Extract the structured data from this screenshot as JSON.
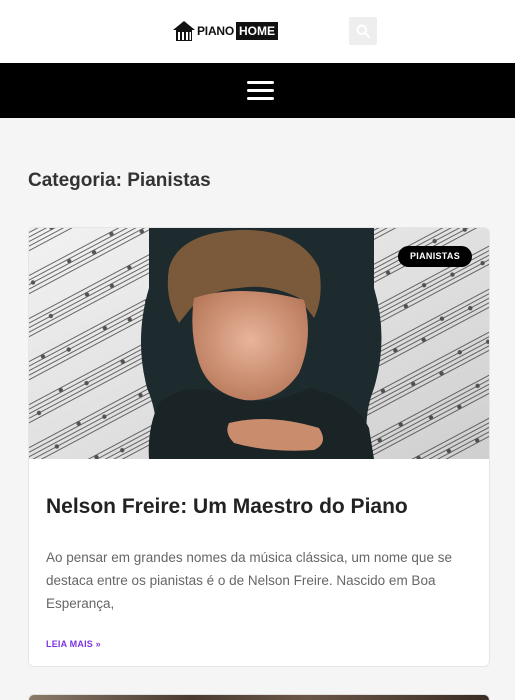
{
  "header": {
    "logo_piano": "PIANO",
    "logo_home": "HOME",
    "search_icon": "search-icon",
    "menu_icon": "hamburger-menu-icon"
  },
  "page": {
    "category_title": "Categoria: Pianistas"
  },
  "post": {
    "badge": "PIANISTAS",
    "title": "Nelson Freire: Um Maestro do Piano",
    "excerpt": "Ao pensar em grandes nomes da música clássica, um nome que se destaca entre os pianistas é o de Nelson Freire. Nascido em Boa Esperança,",
    "read_more": "LEIA MAIS »"
  },
  "colors": {
    "navbar": "#000000",
    "read_more": "#7b35e0",
    "badge_bg": "#000000"
  }
}
